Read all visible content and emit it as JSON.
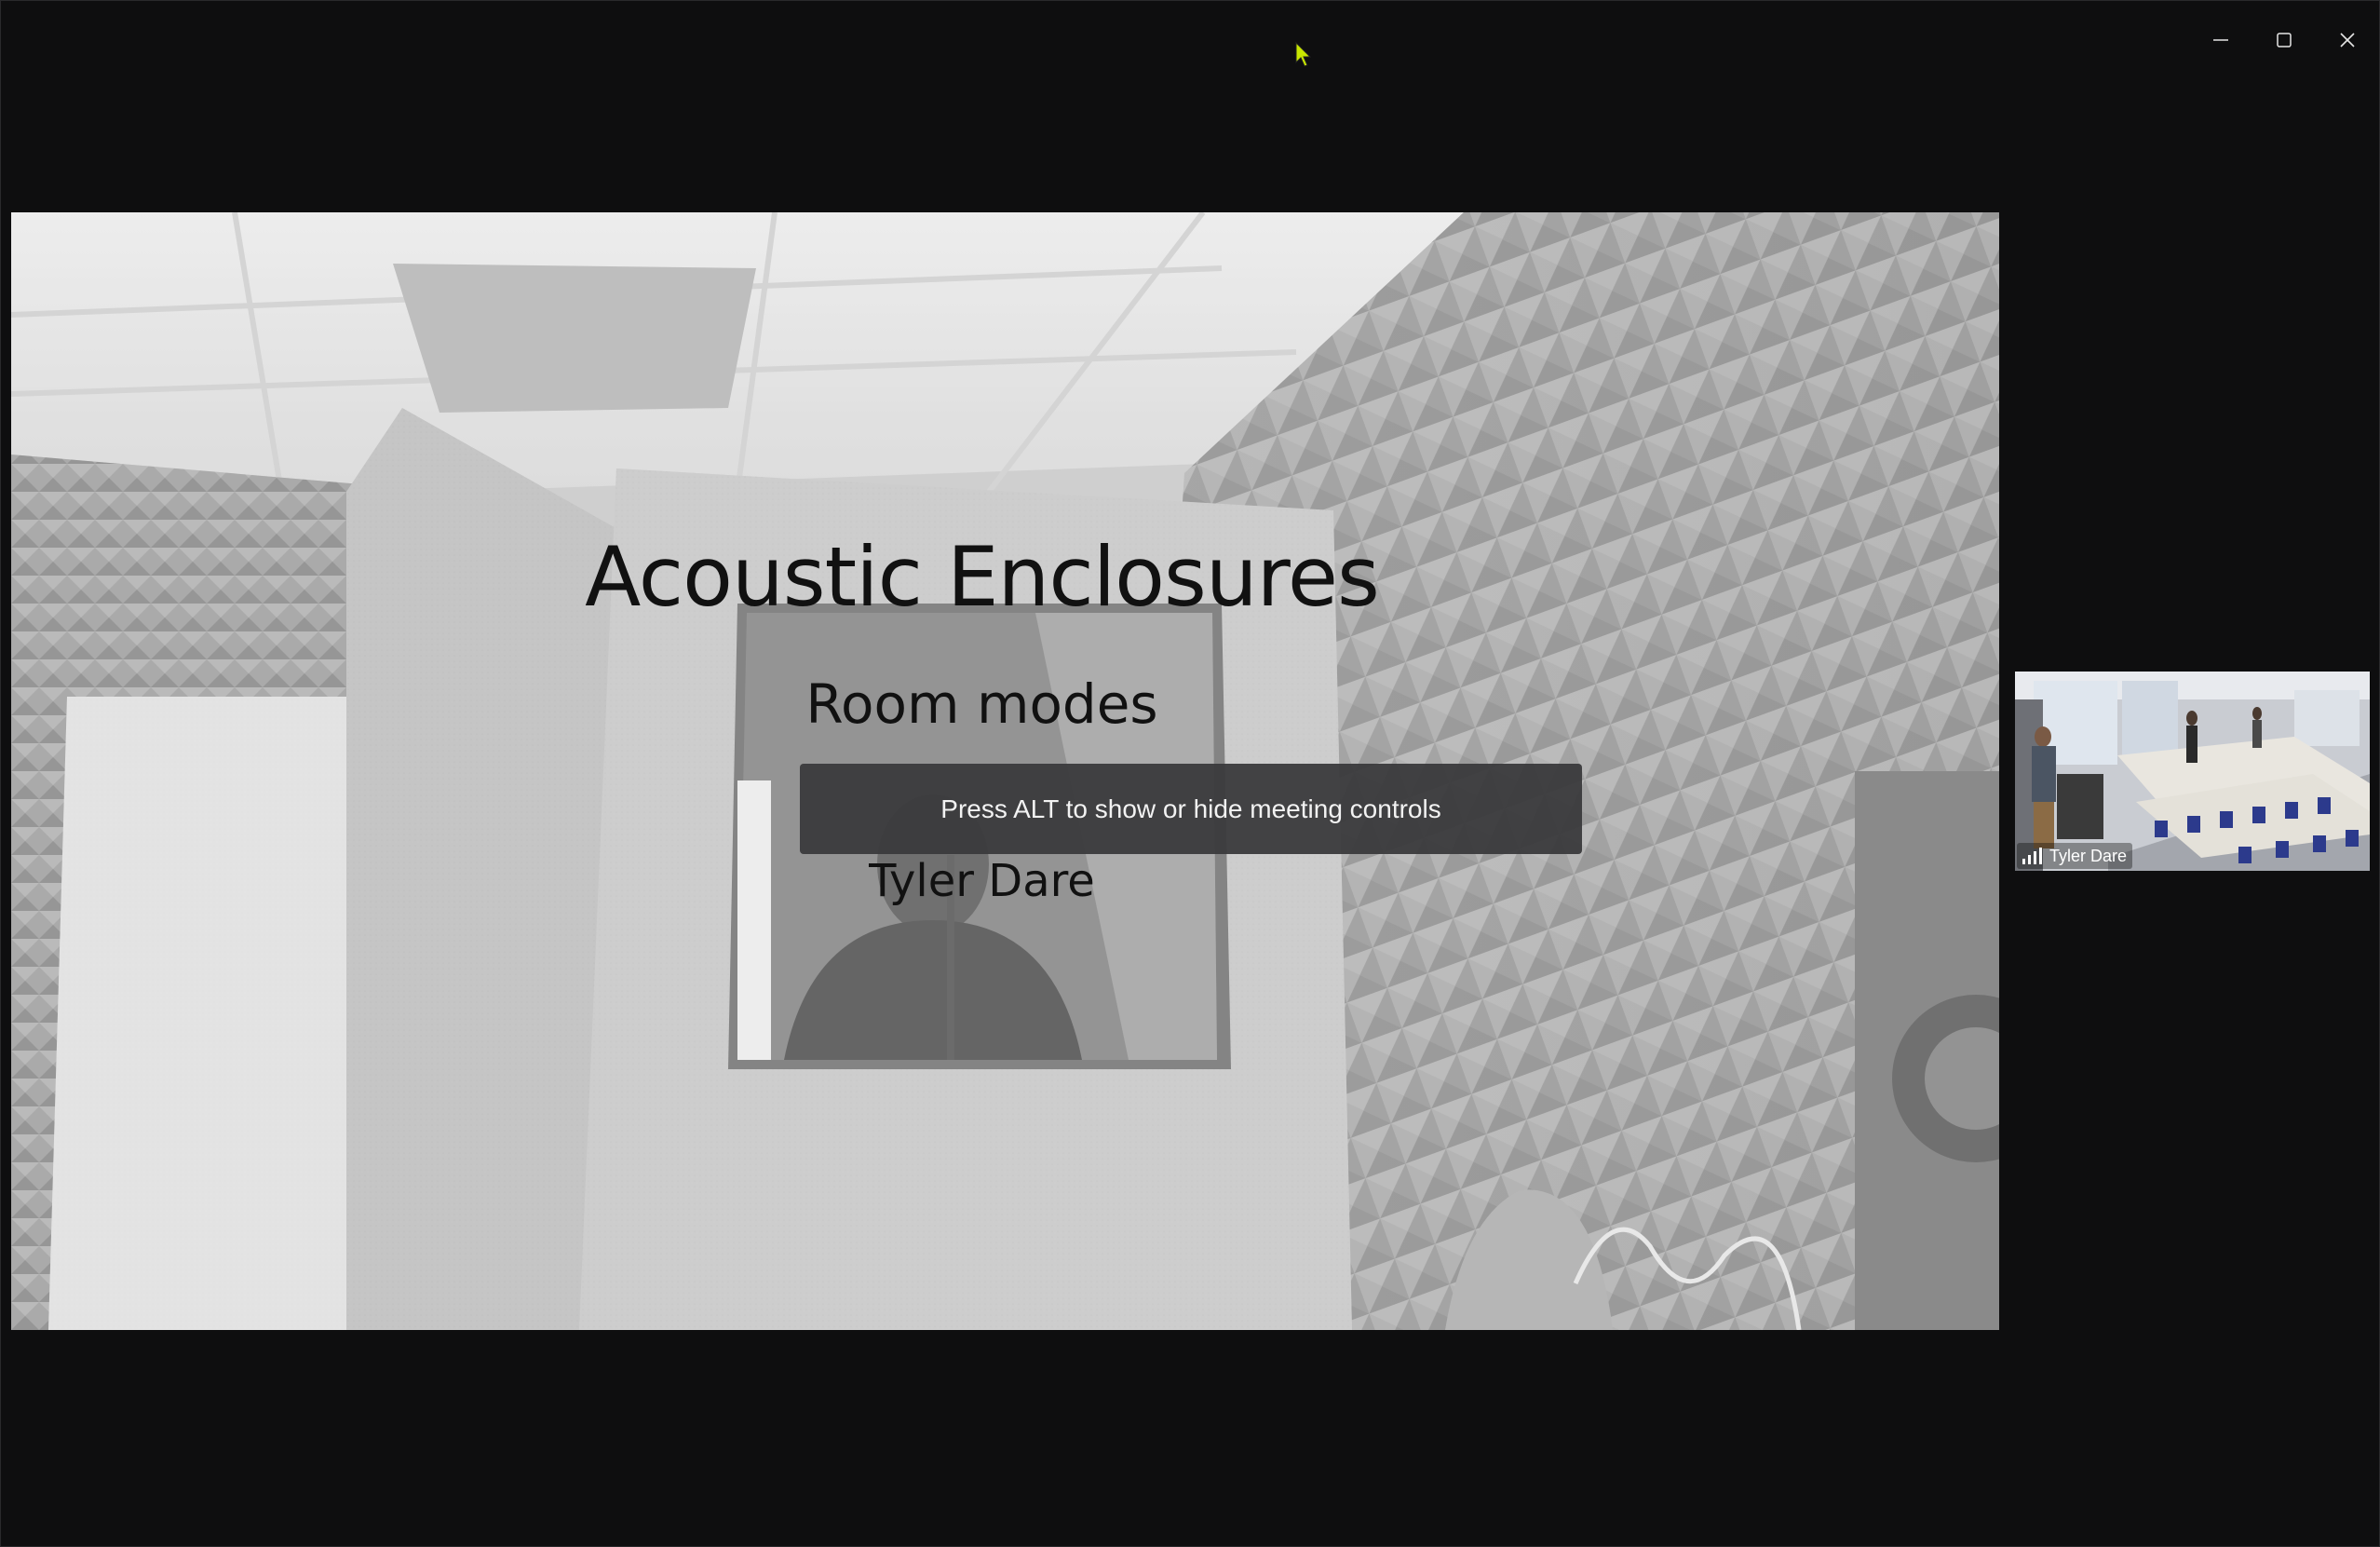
{
  "window": {
    "controls": [
      {
        "name": "minimize-icon"
      },
      {
        "name": "maximize-icon"
      },
      {
        "name": "close-icon"
      }
    ]
  },
  "slide": {
    "title": "Acoustic Enclosures",
    "subtitle": "Room modes",
    "author": "Tyler Dare"
  },
  "toast": {
    "message": "Press ALT to show or hide meeting controls"
  },
  "participant": {
    "name": "Tyler Dare",
    "icon": "signal-strength-icon"
  },
  "colors": {
    "background": "#0e0e0f",
    "toast_bg": "#3a3a3c",
    "cursor": "#c8e600"
  }
}
